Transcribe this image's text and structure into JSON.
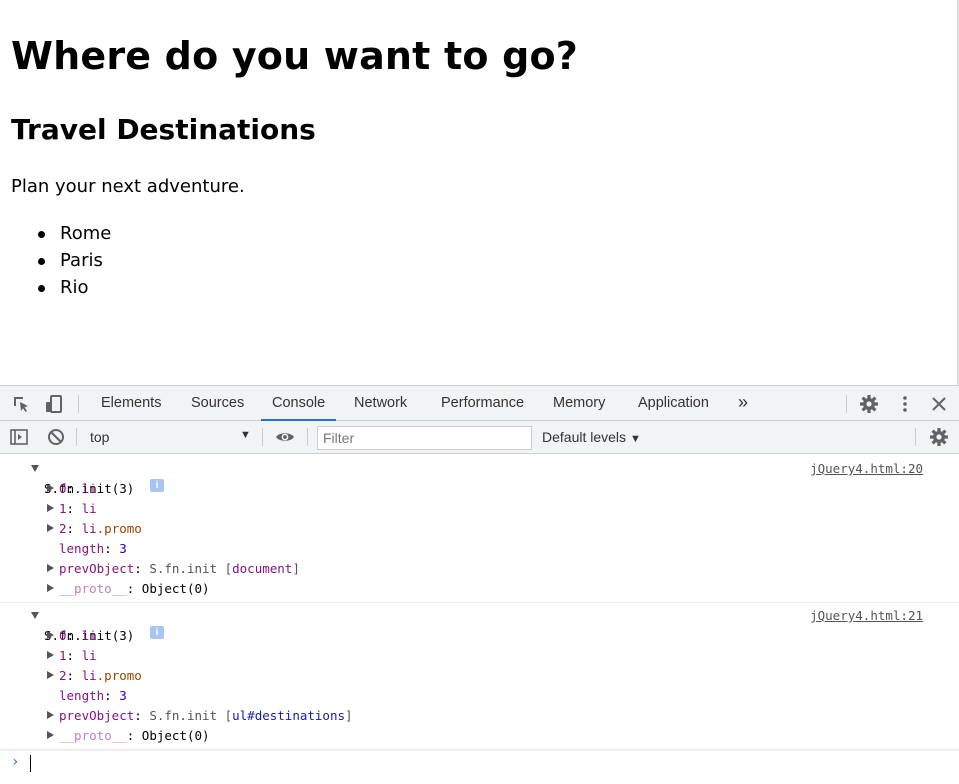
{
  "page": {
    "heading": "Where do you want to go?",
    "subheading": "Travel Destinations",
    "paragraph": "Plan your next adventure.",
    "destinations": [
      "Rome",
      "Paris",
      "Rio"
    ]
  },
  "devtools": {
    "tabs": [
      "Elements",
      "Sources",
      "Console",
      "Network",
      "Performance",
      "Memory",
      "Application"
    ],
    "active_tab": "Console",
    "more_tabs": "»",
    "context": "top",
    "filter_placeholder": "Filter",
    "levels": "Default levels",
    "icons": [
      "inspect-icon",
      "device-toggle-icon",
      "settings-icon",
      "kebab-menu-icon",
      "close-icon",
      "sidebar-toggle-icon",
      "clear-console-icon",
      "eye-icon",
      "console-settings-icon"
    ]
  },
  "console": {
    "entries": [
      {
        "header": "S.fn.init(3)",
        "source": "jQuery4.html:20",
        "items": [
          {
            "key": "0",
            "value": "li",
            "cls": ""
          },
          {
            "key": "1",
            "value": "li",
            "cls": ""
          },
          {
            "key": "2",
            "value": "li",
            "cls": ".promo"
          }
        ],
        "length_key": "length",
        "length_val": "3",
        "prev_key": "prevObject",
        "prev_val": "S.fn.init [",
        "prev_target": "document",
        "prev_close": "]",
        "proto_key": "__proto__",
        "proto_val": "Object(0)"
      },
      {
        "header": "S.fn.init(3)",
        "source": "jQuery4.html:21",
        "items": [
          {
            "key": "0",
            "value": "li",
            "cls": ""
          },
          {
            "key": "1",
            "value": "li",
            "cls": ""
          },
          {
            "key": "2",
            "value": "li",
            "cls": ".promo"
          }
        ],
        "length_key": "length",
        "length_val": "3",
        "prev_key": "prevObject",
        "prev_val": "S.fn.init [",
        "prev_target": "ul#destinations",
        "prev_close": "]",
        "proto_key": "__proto__",
        "proto_val": "Object(0)"
      }
    ],
    "prompt": "›"
  }
}
